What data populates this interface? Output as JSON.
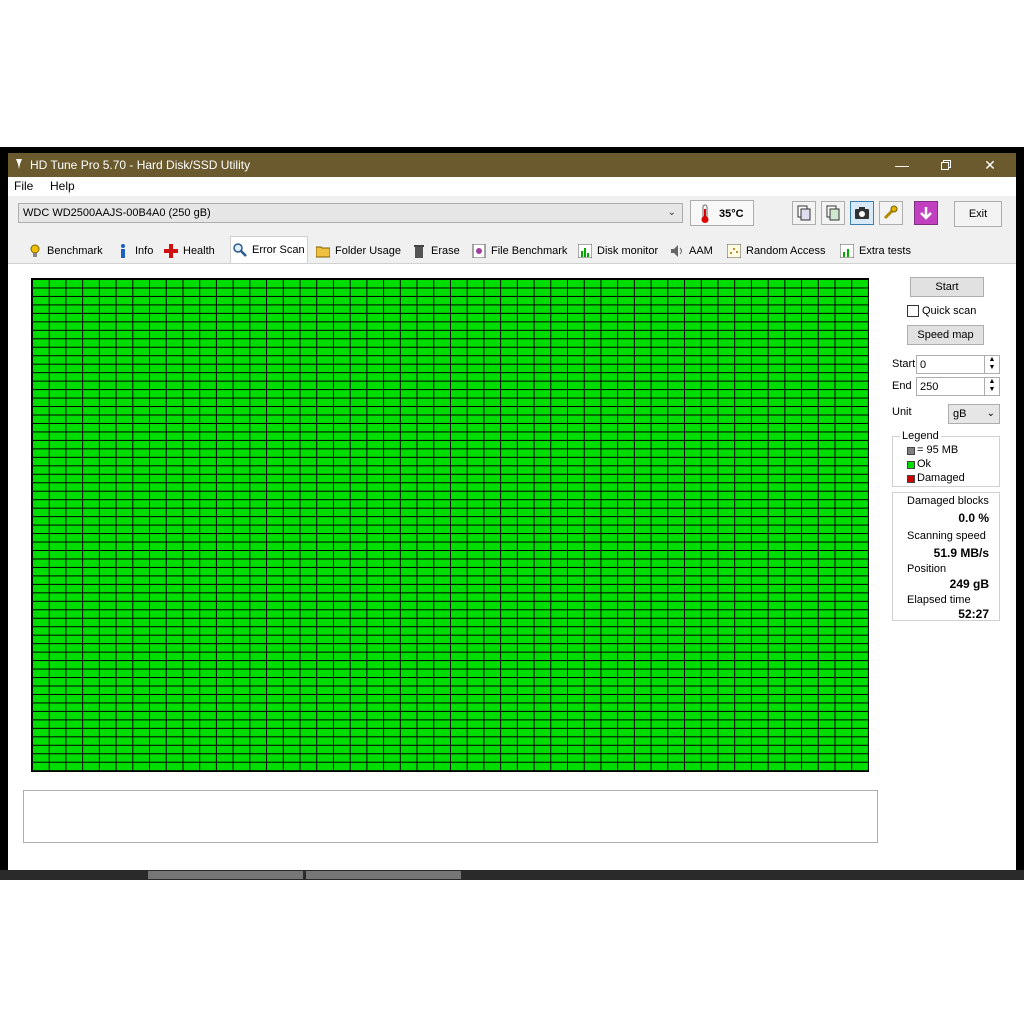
{
  "window": {
    "title": "HD Tune Pro 5.70 - Hard Disk/SSD Utility"
  },
  "menu": {
    "file": "File",
    "help": "Help"
  },
  "toolbar": {
    "drive": "WDC WD2500AAJS-00B4A0 (250 gB)",
    "temperature": "35°C",
    "exit_label": "Exit"
  },
  "tabs": [
    {
      "label": "Benchmark"
    },
    {
      "label": "Info"
    },
    {
      "label": "Health"
    },
    {
      "label": "Error Scan"
    },
    {
      "label": "Folder Usage"
    },
    {
      "label": "Erase"
    },
    {
      "label": "File Benchmark"
    },
    {
      "label": "Disk monitor"
    },
    {
      "label": "AAM"
    },
    {
      "label": "Random Access"
    },
    {
      "label": "Extra tests"
    }
  ],
  "active_tab": "Error Scan",
  "scan": {
    "grid_color": "#00dd00",
    "grid_columns": 50,
    "grid_rows": 58
  },
  "controls": {
    "start_button": "Start",
    "quick_scan_label": "Quick scan",
    "quick_scan_checked": false,
    "speed_map_button": "Speed map",
    "start_label": "Start",
    "start_value": "0",
    "end_label": "End",
    "end_value": "250",
    "unit_label": "Unit",
    "unit_value": "gB"
  },
  "legend": {
    "title": "Legend",
    "block_size": "= 95 MB",
    "ok": "Ok",
    "damaged": "Damaged",
    "block_color": "#808080",
    "ok_color": "#00dd00",
    "damaged_color": "#cc0000"
  },
  "stats": {
    "damaged_blocks_label": "Damaged blocks",
    "damaged_blocks_value": "0.0 %",
    "scanning_speed_label": "Scanning speed",
    "scanning_speed_value": "51.9 MB/s",
    "position_label": "Position",
    "position_value": "249 gB",
    "elapsed_label": "Elapsed time",
    "elapsed_value": "52:27"
  }
}
